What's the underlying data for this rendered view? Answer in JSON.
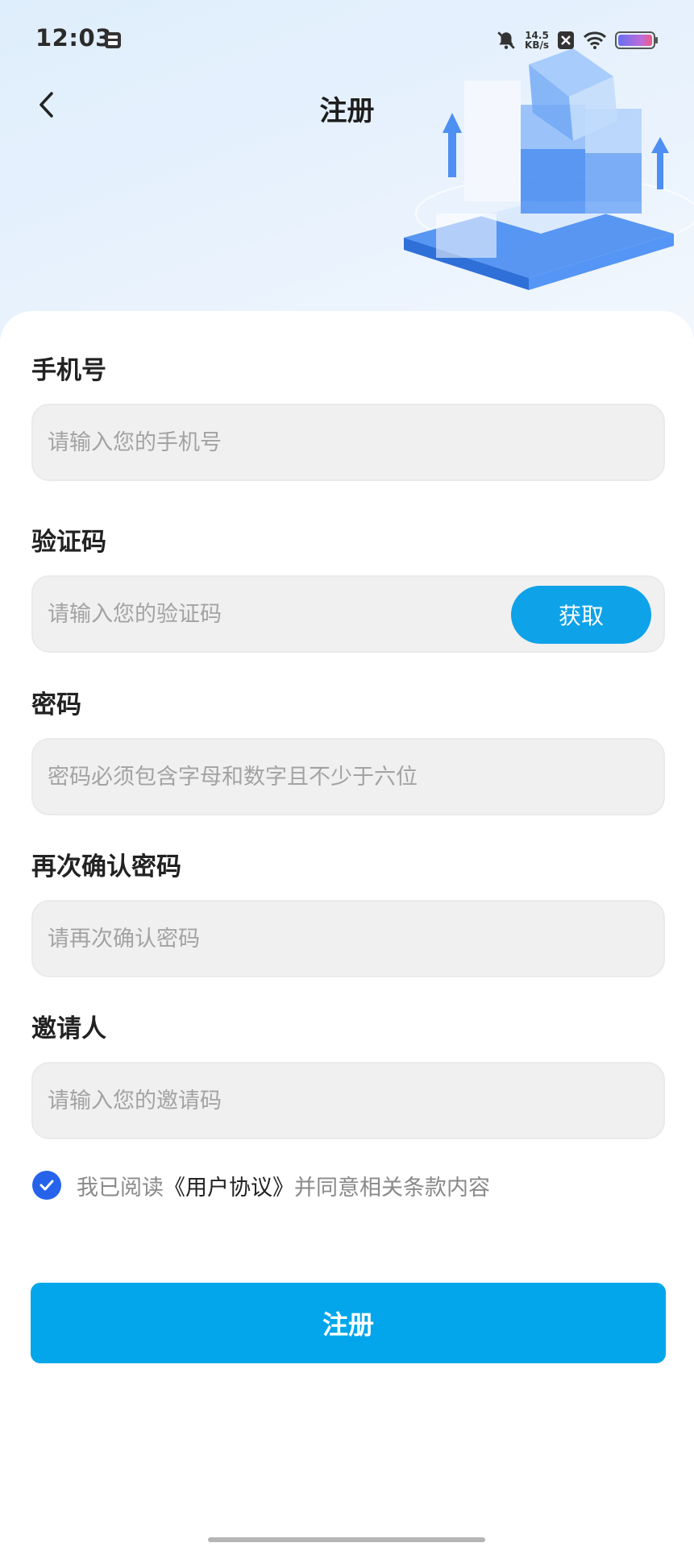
{
  "status_bar": {
    "time": "12:03",
    "speed_value": "14.5",
    "speed_unit": "KB/s",
    "icons": [
      "storage-icon",
      "mute-icon",
      "sim-off-icon",
      "wifi-icon",
      "battery-icon"
    ]
  },
  "header": {
    "title": "注册",
    "back_icon": "chevron-left-icon"
  },
  "form": {
    "phone": {
      "label": "手机号",
      "placeholder": "请输入您的手机号",
      "value": ""
    },
    "code": {
      "label": "验证码",
      "placeholder": "请输入您的验证码",
      "value": "",
      "button": "获取"
    },
    "password": {
      "label": "密码",
      "placeholder": "密码必须包含字母和数字且不少于六位",
      "value": ""
    },
    "confirm": {
      "label": "再次确认密码",
      "placeholder": "请再次确认密码",
      "value": ""
    },
    "inviter": {
      "label": "邀请人",
      "placeholder": "请输入您的邀请码",
      "value": ""
    }
  },
  "agreement": {
    "checked": true,
    "prefix": "我已阅读",
    "link": "《用户协议》",
    "suffix": "并同意相关条款内容"
  },
  "submit_label": "注册",
  "colors": {
    "accent": "#03a6ea",
    "checkbox": "#2563eb",
    "field_bg": "#f0f0f0",
    "placeholder": "#a3a3a3"
  }
}
